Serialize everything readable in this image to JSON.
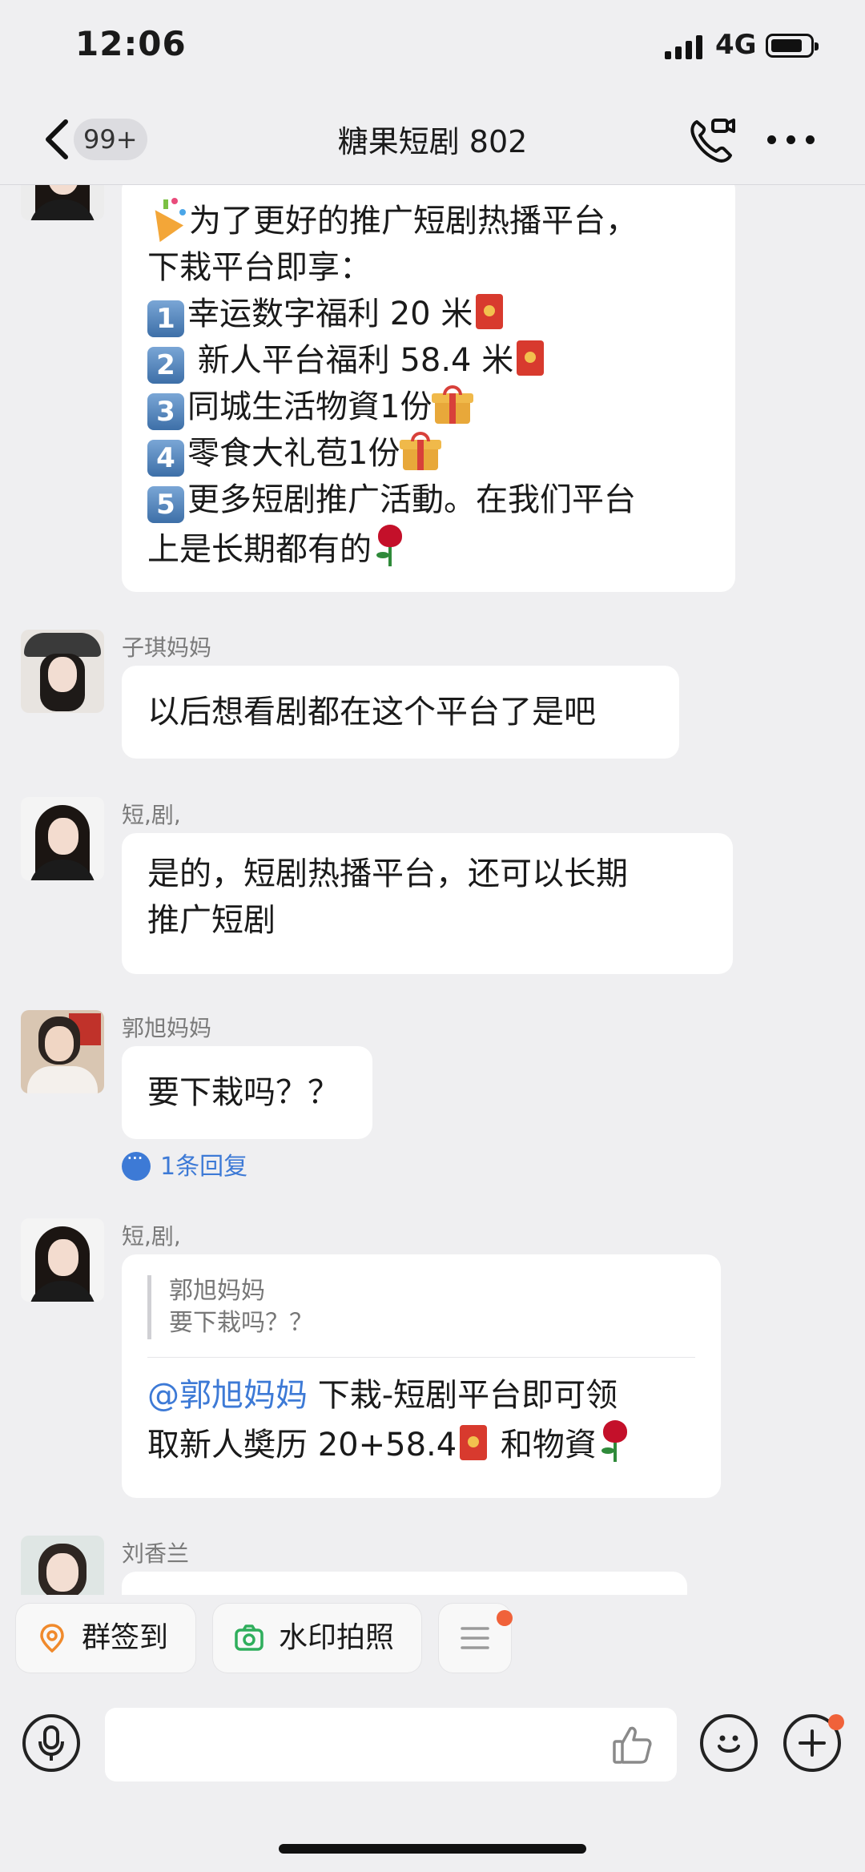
{
  "status_bar": {
    "time": "12:06",
    "network": "4G"
  },
  "header": {
    "unread_badge": "99+",
    "title": "糖果短剧 802"
  },
  "messages": [
    {
      "lines": [
        "为了更好的推广短剧热播平台，",
        "下栽平台即享：",
        "幸运数字福利 20 米",
        " 新人平台福利 58.4 米",
        "同城生活物資1份",
        "零食大礼苞1份",
        "更多短剧推广活動。在我们平台",
        "上是长期都有的"
      ],
      "keycaps": [
        "1",
        "2",
        "3",
        "4",
        "5"
      ]
    },
    {
      "sender": "子琪妈妈",
      "text": "以后想看剧都在这个平台了是吧"
    },
    {
      "sender": "短,剧,",
      "lines": [
        " 是的，短剧热播平台，还可以长期",
        "推广短剧"
      ]
    },
    {
      "sender": "郭旭妈妈",
      "text": "要下栽吗？？",
      "reply_count": "1条回复"
    },
    {
      "sender": "短,剧,",
      "quote_name": "郭旭妈妈",
      "quote_text": "要下栽吗？？",
      "mention": "@郭旭妈妈",
      "line1_rest": "  下栽-短剧平台即可领",
      "line2": "取新人奬历 20+58.4",
      "line2_tail": " 和物資"
    },
    {
      "sender": "刘香兰"
    }
  ],
  "quick_actions": [
    {
      "label": "群签到"
    },
    {
      "label": "水印拍照"
    }
  ],
  "colors": {
    "accent_blue": "#3d7ad6",
    "background": "#efeff1",
    "notification_dot": "#f0623a"
  }
}
